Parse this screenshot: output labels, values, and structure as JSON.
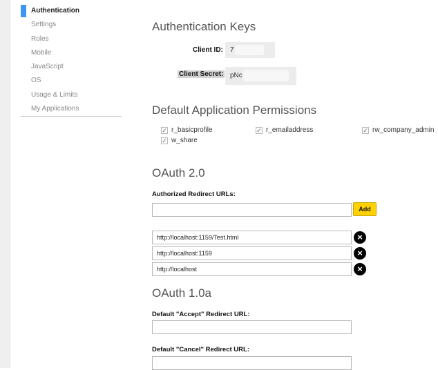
{
  "sidebar": {
    "items": [
      {
        "label": "Authentication",
        "active": true
      },
      {
        "label": "Settings"
      },
      {
        "label": "Roles"
      },
      {
        "label": "Mobile"
      },
      {
        "label": "JavaScript"
      },
      {
        "label": "OS"
      },
      {
        "label": "Usage & Limits"
      },
      {
        "label": "My Applications"
      }
    ]
  },
  "auth_keys": {
    "heading": "Authentication Keys",
    "client_id_label": "Client ID:",
    "client_id_value": "7",
    "client_secret_label": "Client Secret:",
    "client_secret_value": "pNc"
  },
  "permissions": {
    "heading": "Default Application Permissions",
    "items": [
      {
        "label": "r_basicprofile",
        "checked": true
      },
      {
        "label": "r_emailaddress",
        "checked": true
      },
      {
        "label": "rw_company_admin",
        "checked": true
      },
      {
        "label": "w_share",
        "checked": true
      }
    ]
  },
  "oauth2": {
    "heading": "OAuth 2.0",
    "redirect_label": "Authorized Redirect URLs:",
    "new_url_value": "",
    "add_label": "Add",
    "urls": [
      "http://localhost:1159/Test.html",
      "http://localhost:1159",
      "http://localhost"
    ]
  },
  "oauth1": {
    "heading": "OAuth 1.0a",
    "accept_label": "Default \"Accept\" Redirect URL:",
    "accept_value": "",
    "cancel_label": "Default \"Cancel\" Redirect URL:",
    "cancel_value": ""
  },
  "colors": {
    "active_marker": "#3e97ee",
    "add_button": "#ffd100",
    "remove_icon": "#000000"
  },
  "icons": {
    "remove": "close-circle-icon",
    "checkbox": "checkmark-icon"
  }
}
